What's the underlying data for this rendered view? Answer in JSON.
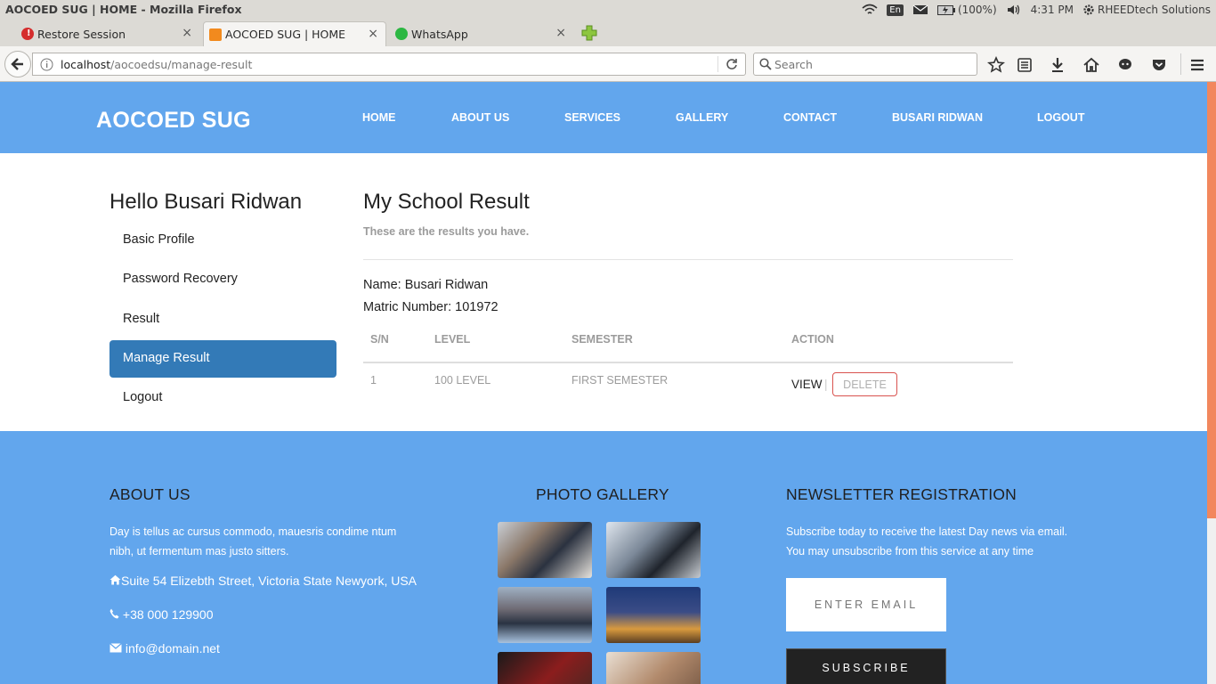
{
  "window": {
    "title": "AOCOED SUG | HOME - Mozilla Firefox"
  },
  "tray": {
    "lang": "En",
    "battery": "(100%)",
    "time": "4:31 PM",
    "user": "RHEEDtech Solutions"
  },
  "tabs": [
    {
      "label": "Restore Session"
    },
    {
      "label": "AOCOED SUG | HOME"
    },
    {
      "label": "WhatsApp"
    }
  ],
  "nav": {
    "url_host": "localhost",
    "url_path": "/aocoedsu/manage-result",
    "search_placeholder": "Search"
  },
  "site": {
    "brand": "AOCOED SUG",
    "menu": [
      "HOME",
      "ABOUT US",
      "SERVICES",
      "GALLERY",
      "CONTACT",
      "BUSARI RIDWAN",
      "LOGOUT"
    ]
  },
  "sidebar": {
    "greeting": "Hello Busari Ridwan",
    "items": [
      "Basic Profile",
      "Password Recovery",
      "Result",
      "Manage Result",
      "Logout"
    ]
  },
  "content": {
    "title": "My School Result",
    "subtitle": "These are the results you have.",
    "name_line": "Name: Busari Ridwan",
    "matric_line": "Matric Number: 101972",
    "table": {
      "headers": [
        "S/N",
        "LEVEL",
        "SEMESTER",
        "ACTION"
      ],
      "rows": [
        {
          "sn": "1",
          "level": "100 LEVEL",
          "semester": "FIRST SEMESTER",
          "view": "VIEW",
          "sep": "|",
          "delete": "DELETE"
        }
      ]
    }
  },
  "footer": {
    "about_title": "ABOUT US",
    "about_text_1": "Day is tellus ac cursus commodo, mauesris condime ntum",
    "about_text_2": "nibh, ut fermentum mas justo sitters.",
    "address": "Suite 54 Elizebth Street, Victoria State Newyork, USA",
    "phone": "+38 000 129900",
    "email": "info@domain.net",
    "gallery_title": "PHOTO GALLERY",
    "newsletter_title": "NEWSLETTER REGISTRATION",
    "newsletter_text_1": "Subscribe today to receive the latest Day news via email.",
    "newsletter_text_2": "You may unsubscribe from this service at any time",
    "email_placeholder": "ENTER EMAIL",
    "subscribe_label": "SUBSCRIBE"
  },
  "colors": {
    "header": "#62a6ed",
    "active": "#337ab7",
    "delete_border": "#d9534f",
    "scroll_thumb": "#f2875d"
  }
}
